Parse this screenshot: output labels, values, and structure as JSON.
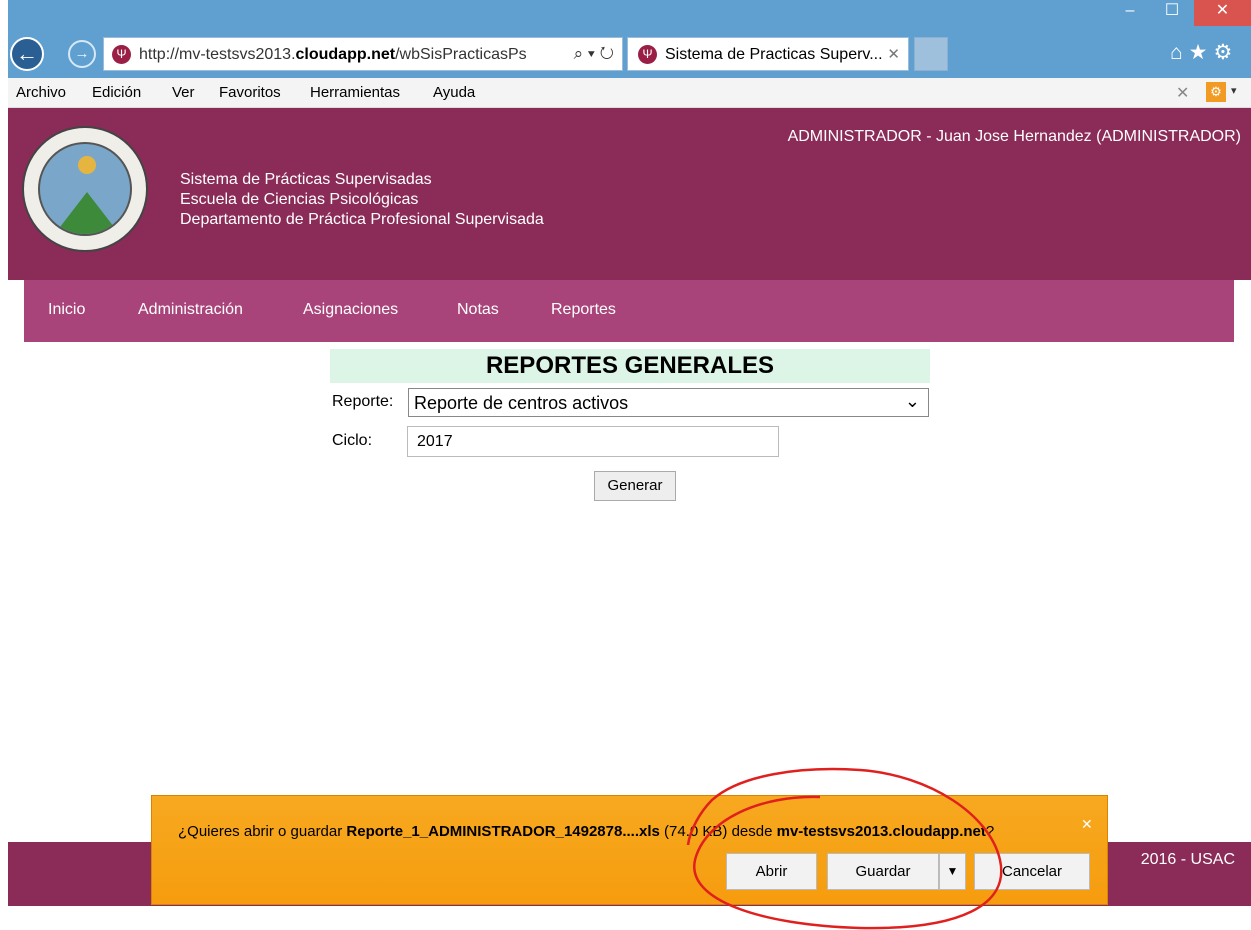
{
  "browser": {
    "window_controls": {
      "minimize": "–",
      "maximize": "☐",
      "close": "✕"
    },
    "nav": {
      "back_icon": "←",
      "forward_icon": "→"
    },
    "address": {
      "prefix": "http://mv-testsvs2013.",
      "domain": "cloudapp.net",
      "suffix": "/wbSisPracticasPs",
      "icons": "⌕ ▾ ↻"
    },
    "tab": {
      "icon": "Ψ",
      "title": "Sistema de Practicas Superv...",
      "close": "✕"
    },
    "right_icons": "⌂★⚙",
    "menu": [
      "Archivo",
      "Edición",
      "Ver",
      "Favoritos",
      "Herramientas",
      "Ayuda"
    ],
    "menu_close": "✕",
    "menu_gear": "⚙",
    "menu_caret": "▾"
  },
  "header": {
    "line1": "Sistema de Prácticas Supervisadas",
    "line2": "Escuela de Ciencias Psicológicas",
    "line3": "Departamento de Práctica Profesional Supervisada",
    "user": "ADMINISTRADOR - Juan Jose Hernandez (ADMINISTRADOR)"
  },
  "navbar": {
    "items": [
      "Inicio",
      "Administración",
      "Asignaciones",
      "Notas",
      "Reportes"
    ]
  },
  "form": {
    "title": "REPORTES GENERALES",
    "report_label": "Reporte:",
    "report_value": "Reporte de centros activos",
    "cycle_label": "Ciclo:",
    "cycle_value": "2017",
    "generate_button": "Generar"
  },
  "footer": {
    "text": "2016 - USAC"
  },
  "download_bar": {
    "prefix": "¿Quieres abrir o guardar ",
    "filename": "Reporte_1_ADMINISTRADOR_1492878....xls",
    "size": " (74.0 KB) desde ",
    "source": "mv-testsvs2013.cloudapp.net",
    "suffix": "?",
    "close": "✕",
    "open_button": "Abrir",
    "save_button": "Guardar",
    "save_dropdown": "▼",
    "cancel_button": "Cancelar"
  },
  "colors": {
    "header_bg": "#8a2b58",
    "navbar_bg": "#a8447a",
    "title_bg": "#dcf5e6",
    "download_bar_bg": "#f7a920",
    "annotation_red": "#e0201e"
  }
}
